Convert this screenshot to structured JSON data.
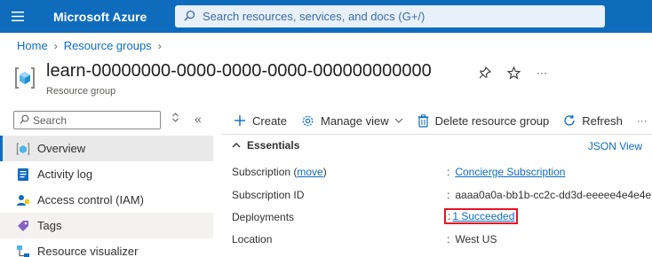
{
  "topbar": {
    "brand": "Microsoft Azure",
    "search_placeholder": "Search resources, services, and docs (G+/)",
    "bg_color": "#0f6cbd"
  },
  "breadcrumb": [
    "Home",
    "Resource groups"
  ],
  "resource": {
    "title": "learn-00000000-0000-0000-0000-000000000000",
    "subtitle": "Resource group",
    "icon": "resource-group-icon",
    "more": "···"
  },
  "sidebar": {
    "search_placeholder": "Search",
    "collapse_glyph": "«",
    "items": [
      {
        "label": "Overview",
        "icon": "overview-icon",
        "active": true
      },
      {
        "label": "Activity log",
        "icon": "activity-log-icon"
      },
      {
        "label": "Access control (IAM)",
        "icon": "iam-icon"
      },
      {
        "label": "Tags",
        "icon": "tag-icon"
      },
      {
        "label": "Resource visualizer",
        "icon": "visualizer-icon"
      }
    ]
  },
  "commands": {
    "create": "Create",
    "manage_view": "Manage view",
    "delete": "Delete resource group",
    "refresh": "Refresh",
    "more": "···"
  },
  "essentials": {
    "header": "Essentials",
    "json_view": "JSON View",
    "subscription_label": "Subscription",
    "move_link": "move",
    "subscription_value": "Concierge Subscription",
    "subscription_id_label": "Subscription ID",
    "subscription_id_value": "aaaa0a0a-bb1b-cc2c-dd3d-eeeee4e4e4e",
    "deployments_label": "Deployments",
    "deployments_value": "1 Succeeded",
    "location_label": "Location",
    "location_value": "West US",
    "colon": ":"
  },
  "colors": {
    "accent": "#0f6cbd",
    "highlight": "#e81123"
  }
}
